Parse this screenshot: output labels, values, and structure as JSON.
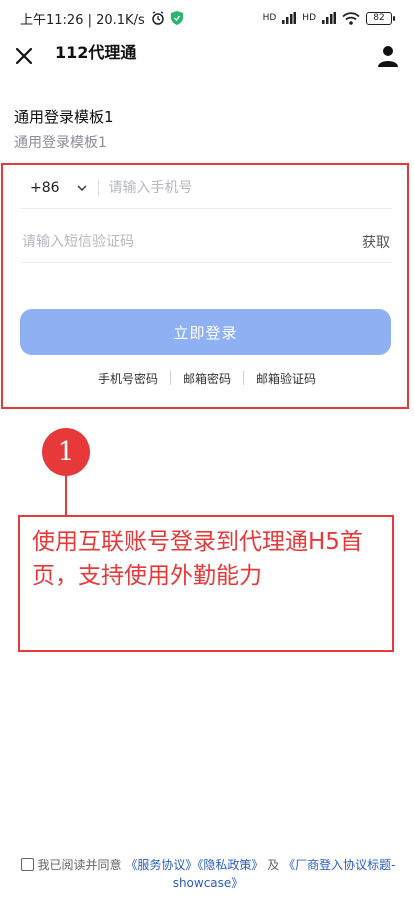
{
  "status_bar": {
    "time_speed": "上午11:26 | 20.1K/s",
    "signal_1": "HD",
    "signal_2": "HD",
    "battery": "82"
  },
  "nav": {
    "title": "112代理通"
  },
  "template": {
    "title": "通用登录模板1",
    "subtitle": "通用登录模板1"
  },
  "login_form": {
    "country_code": "+86",
    "phone_placeholder": "请输入手机号",
    "sms_placeholder": "请输入短信验证码",
    "get_code_label": "获取",
    "login_button": "立即登录",
    "alt_methods": [
      "手机号密码",
      "邮箱密码",
      "邮箱验证码"
    ]
  },
  "annotation": {
    "step_number": "1",
    "text": "使用互联账号登录到代理通H5首页，支持使用外勤能力"
  },
  "agreement": {
    "prefix": "我已阅读并同意",
    "service": "《服务协议》",
    "privacy": "《隐私政策》",
    "and": "及",
    "vendor": "《厂商登入协议标题-showcase》"
  },
  "colors": {
    "accent_red": "#e8393a",
    "button_blue": "#8fb1f4",
    "link_blue": "#2a5cc7"
  }
}
